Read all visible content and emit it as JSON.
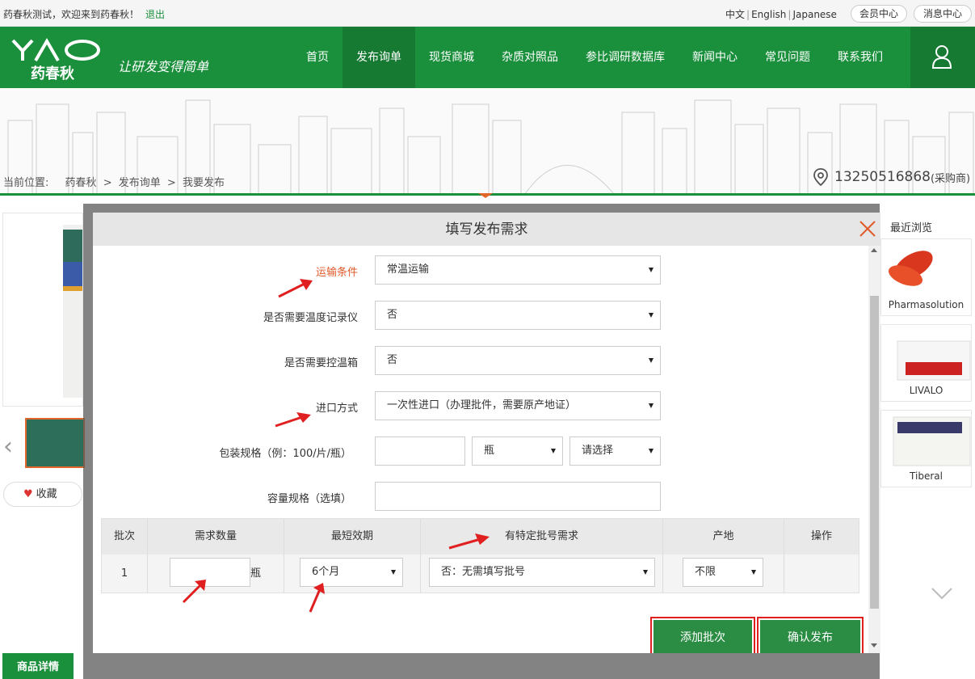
{
  "topbar": {
    "welcome": "药春秋测试，欢迎来到药春秋！",
    "logout": "退出",
    "lang_zh": "中文",
    "lang_en": "English",
    "lang_ja": "Japanese",
    "member_center": "会员中心",
    "messages": "消息中心"
  },
  "header": {
    "logo_text": "YAO",
    "logo_cn": "药春秋",
    "slogan": "让研发变得简单",
    "nav": [
      "首页",
      "发布询单",
      "现货商城",
      "杂质对照品",
      "参比调研数据库",
      "新闻中心",
      "常见问题",
      "联系我们"
    ],
    "active_nav": "发布询单"
  },
  "breadcrumb": {
    "label": "当前位置:",
    "items": [
      "药春秋",
      "发布询单",
      "我要发布"
    ],
    "separator": ">"
  },
  "contact": {
    "phone": "13250516868",
    "role": "(采购商)"
  },
  "product": {
    "favorite": "收藏",
    "detail_tab": "商品详情"
  },
  "recent": {
    "title": "最近浏览",
    "items": [
      "Pharmasolution",
      "LIVALO",
      "Tiberal"
    ]
  },
  "modal": {
    "title": "填写发布需求",
    "fields": {
      "transport": {
        "label": "运输条件",
        "value": "常温运输"
      },
      "temp_recorder": {
        "label": "是否需要温度记录仪",
        "value": "否"
      },
      "temp_box": {
        "label": "是否需要控温箱",
        "value": "否"
      },
      "import_method": {
        "label": "进口方式",
        "value": "一次性进口（办理批件，需要原产地证）"
      },
      "package_spec": {
        "label": "包装规格（例：100/片/瓶）",
        "value": "",
        "unit": "瓶",
        "select_placeholder": "请选择"
      },
      "capacity_spec": {
        "label": "容量规格（选填）",
        "value": ""
      }
    },
    "table": {
      "headers": [
        "批次",
        "需求数量",
        "最短效期",
        "有特定批号需求",
        "产地",
        "操作"
      ],
      "rows": [
        {
          "batch": "1",
          "quantity": "",
          "unit": "瓶",
          "shelf_life": "6个月",
          "batch_req": "否：无需填写批号",
          "origin": "不限"
        }
      ]
    },
    "add_batch": "添加批次",
    "confirm": "确认发布"
  },
  "colors": {
    "brand_green": "#1a8f3c",
    "button_green": "#2b8c44",
    "highlight_red": "#e02020",
    "label_orange": "#e05a2a"
  }
}
